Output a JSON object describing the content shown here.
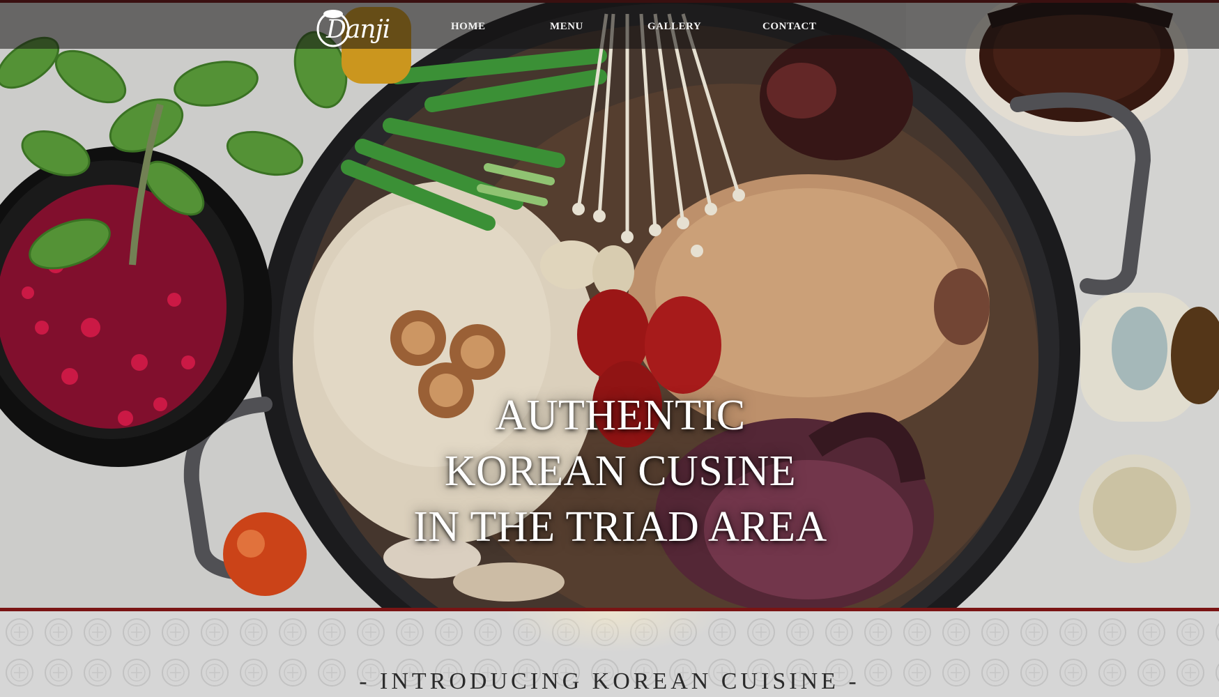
{
  "brand": {
    "logo_text": "Danji"
  },
  "nav": {
    "items": [
      {
        "label": "HOME"
      },
      {
        "label": "MENU"
      },
      {
        "label": "GALLERY"
      },
      {
        "label": "CONTACT"
      }
    ]
  },
  "hero": {
    "headline_lines": [
      "AUTHENTIC",
      "KOREAN CUSINE",
      "IN THE TRIAD AREA"
    ]
  },
  "intro": {
    "title": "- INTRODUCING KOREAN CUISINE -"
  },
  "colors": {
    "accent": "#7a1414",
    "nav_bg": "rgba(20,18,18,0.55)",
    "text_light": "#ffffff",
    "intro_bg": "#d6d6d6"
  }
}
